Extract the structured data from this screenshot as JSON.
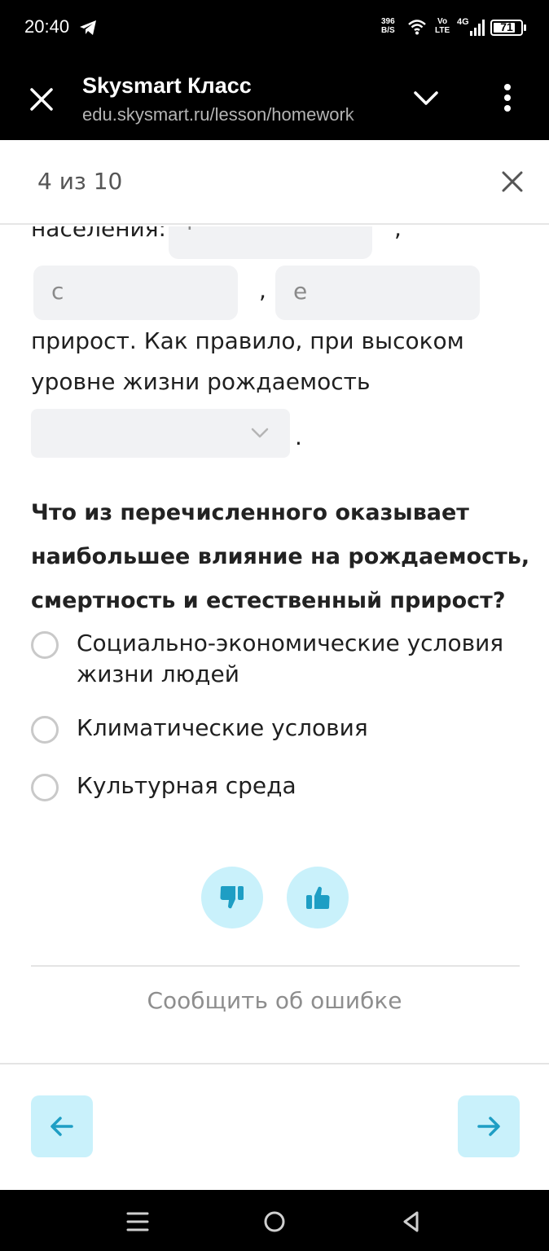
{
  "status_bar": {
    "time": "20:40",
    "speed_value": "396",
    "speed_unit": "B/S",
    "volte_top": "Vo",
    "volte_bottom": "LTE",
    "network": "4G",
    "battery": "71"
  },
  "browser": {
    "title": "Skysmart Класс",
    "url": "edu.skysmart.ru/lesson/homework"
  },
  "progress": {
    "text": "4 из 10"
  },
  "exercise": {
    "text_fragment_1": "населения:",
    "comma_1": ",",
    "comma_2": ",",
    "field_1_placeholder": "р",
    "field_2_placeholder": "с",
    "field_3_placeholder": "е",
    "line_2": "прирост. Как правило, при высоком",
    "line_3": "уровне жизни рождаемость",
    "period": ".",
    "dropdown_value": ""
  },
  "question": {
    "lines": [
      "Что из перечисленного оказывает",
      "наибольшее влияние на рождаемость,",
      "смертность и естественный прирост?"
    ],
    "options": [
      "Социально-экономические условия жизни людей",
      "Климатические условия",
      "Культурная среда"
    ]
  },
  "feedback": {
    "dislike_icon": "thumbs-down-icon",
    "like_icon": "thumbs-up-icon"
  },
  "report": {
    "label": "Сообщить об ошибке"
  },
  "colors": {
    "accent": "#1e9ec4",
    "accent_bg": "#c9f1fb",
    "field_bg": "#f1f2f4"
  }
}
